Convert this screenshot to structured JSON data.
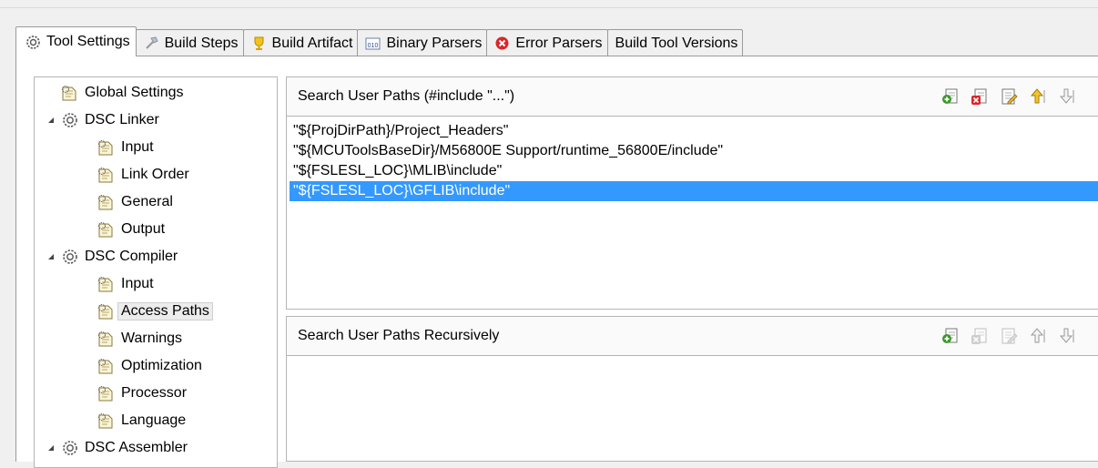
{
  "tabs": [
    {
      "label": "Tool Settings",
      "icon": "gear-icon",
      "active": true
    },
    {
      "label": "Build Steps",
      "icon": "hammer-icon"
    },
    {
      "label": "Build Artifact",
      "icon": "trophy-icon"
    },
    {
      "label": "Binary Parsers",
      "icon": "binary-icon"
    },
    {
      "label": "Error Parsers",
      "icon": "error-icon"
    },
    {
      "label": "Build Tool Versions",
      "icon": ""
    }
  ],
  "tree": {
    "items": [
      {
        "label": "Global Settings"
      },
      {
        "label": "DSC Linker"
      },
      {
        "label": "Input"
      },
      {
        "label": "Link Order"
      },
      {
        "label": "General"
      },
      {
        "label": "Output"
      },
      {
        "label": "DSC Compiler"
      },
      {
        "label": "Input"
      },
      {
        "label": "Access Paths",
        "selected": true
      },
      {
        "label": "Warnings"
      },
      {
        "label": "Optimization"
      },
      {
        "label": "Processor"
      },
      {
        "label": "Language"
      },
      {
        "label": "DSC Assembler"
      }
    ]
  },
  "user_paths": {
    "title": "Search User Paths (#include \"...\")",
    "items": [
      "\"${ProjDirPath}/Project_Headers\"",
      "\"${MCUToolsBaseDir}/M56800E Support/runtime_56800E/include\"",
      "\"${FSLESL_LOC}\\MLIB\\include\"",
      "\"${FSLESL_LOC}\\GFLIB\\include\""
    ],
    "selected_index": 3
  },
  "recursive_paths": {
    "title": "Search User Paths Recursively",
    "items": []
  },
  "toolbar_icons": [
    "add-path-icon",
    "delete-path-icon",
    "edit-path-icon",
    "move-up-icon",
    "move-down-icon"
  ],
  "colors": {
    "selection": "#3399ff",
    "accent_green": "#3a9a2a",
    "error_red": "#d9262b"
  }
}
